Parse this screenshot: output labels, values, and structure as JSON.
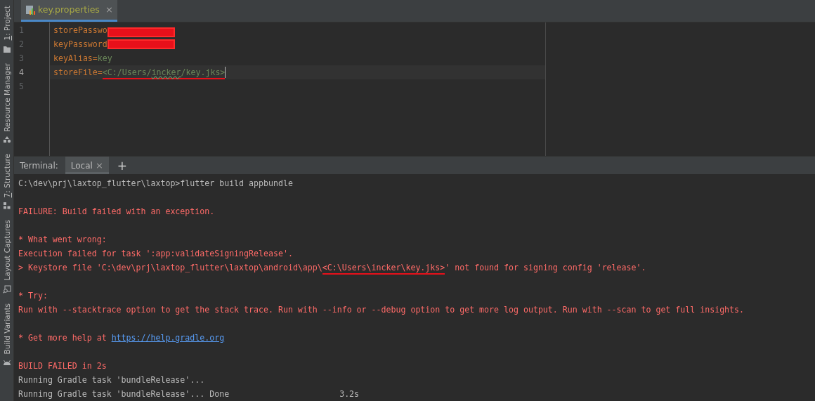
{
  "tool_strip": [
    {
      "label": "1: Project",
      "mnemonic": true
    },
    {
      "label": "Resource Manager",
      "mnemonic": false
    },
    {
      "label": "7: Structure",
      "mnemonic": true
    },
    {
      "label": "Layout Captures",
      "mnemonic": false
    },
    {
      "label": "Build Variants",
      "mnemonic": false
    }
  ],
  "editor_tabs": [
    {
      "label": "key.properties",
      "close": "×",
      "selected": true
    }
  ],
  "editor_lines": [
    {
      "number": "1",
      "current": false,
      "redacted": true,
      "segments": [
        {
          "kind": "key",
          "text": "storePasswo"
        }
      ]
    },
    {
      "number": "2",
      "current": false,
      "redacted": true,
      "segments": [
        {
          "kind": "key",
          "text": "keyPassword"
        }
      ]
    },
    {
      "number": "3",
      "current": false,
      "redacted": false,
      "segments": [
        {
          "kind": "key",
          "text": "keyAlias"
        },
        {
          "kind": "sep",
          "text": "="
        },
        {
          "kind": "value",
          "text": "key"
        }
      ]
    },
    {
      "number": "4",
      "current": true,
      "redacted": false,
      "segments": [
        {
          "kind": "key",
          "text": "storeFile"
        },
        {
          "kind": "sep",
          "text": "="
        },
        {
          "kind": "value",
          "text": "<C:/Users/",
          "marked": true
        },
        {
          "kind": "typo",
          "text": "incker",
          "marked": true
        },
        {
          "kind": "value",
          "text": "/key.jks>",
          "marked": true
        }
      ]
    },
    {
      "number": "5",
      "current": false,
      "redacted": false
    }
  ],
  "terminal": {
    "label": "Terminal:",
    "tabs": [
      {
        "label": "Local",
        "close": "×",
        "selected": true
      }
    ],
    "add": "+",
    "lines": [
      {
        "kind": "normal",
        "text": "C:\\dev\\prj\\laxtop_flutter\\laxtop>flutter build appbundle"
      },
      {
        "kind": "blank"
      },
      {
        "kind": "error",
        "text": "FAILURE: Build failed with an exception."
      },
      {
        "kind": "blank"
      },
      {
        "kind": "error",
        "text": "* What went wrong:"
      },
      {
        "kind": "error",
        "text": "Execution failed for task ':app:validateSigningRelease'."
      },
      {
        "kind": "error",
        "text": "> Keystore file 'C:\\dev\\prj\\laxtop_flutter\\laxtop\\android\\app\\",
        "marked": "<C:\\Users\\incker\\key.jks>",
        "rest": "' not found for signing config 'release'."
      },
      {
        "kind": "blank"
      },
      {
        "kind": "error",
        "text": "* Try:"
      },
      {
        "kind": "error",
        "text": "Run with --stacktrace option to get the stack trace. Run with --info or --debug option to get more log output. Run with --scan to get full insights."
      },
      {
        "kind": "blank"
      },
      {
        "kind": "error",
        "text": "* Get more help at ",
        "link": "https://help.gradle.org"
      },
      {
        "kind": "blank"
      },
      {
        "kind": "error",
        "text": "BUILD FAILED in 2s"
      },
      {
        "kind": "normal",
        "text": "Running Gradle task 'bundleRelease'..."
      },
      {
        "kind": "normal",
        "text": "Running Gradle task 'bundleRelease'... Done",
        "time": "3.2s"
      }
    ]
  }
}
